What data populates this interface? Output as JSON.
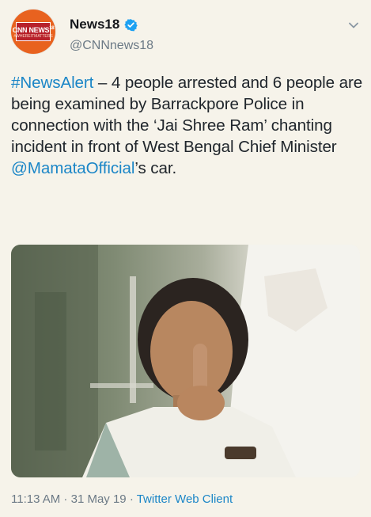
{
  "tweet": {
    "author": {
      "display_name": "News18",
      "handle": "@CNNnews18",
      "avatar_logo_text": "CNN NEWS18",
      "avatar_logo_super": "18",
      "avatar_logo_sub": "#WHEREITMATTERS"
    },
    "body": {
      "hashtag": "#NewsAlert",
      "text_1": " – 4 people arrested and 6 people are being examined by Barrackpore Police in connection with the ‘Jai Shree Ram’ chanting incident in front of West Bengal Chief Minister ",
      "mention": "@MamataOfficial",
      "text_2": "’s car."
    },
    "footer": {
      "time": "11:13 AM",
      "sep_1": " · ",
      "date": "31 May 19",
      "sep_2": " · ",
      "source": "Twitter Web Client"
    }
  },
  "icons": {
    "verified": "verified-badge-icon",
    "menu": "chevron-down-icon"
  },
  "colors": {
    "link": "#1b86c7",
    "avatar_bg": "#e8621f",
    "logo_red": "#b7212b",
    "verified": "#1da1f2",
    "background": "#f6f3ea",
    "muted": "#6c7a86"
  }
}
